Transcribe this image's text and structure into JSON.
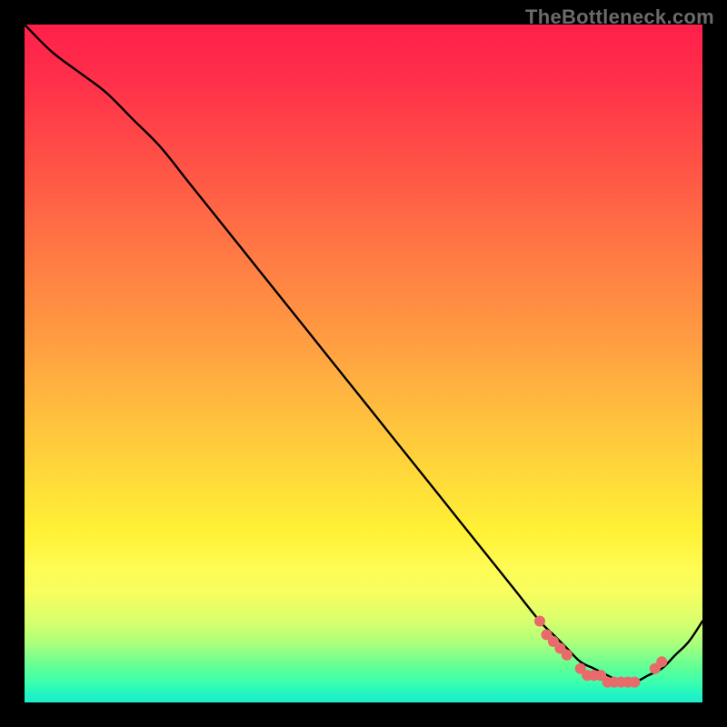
{
  "watermark": "TheBottleneck.com",
  "chart_data": {
    "type": "line",
    "title": "",
    "xlabel": "",
    "ylabel": "",
    "xlim": [
      0,
      100
    ],
    "ylim": [
      0,
      100
    ],
    "grid": false,
    "series": [
      {
        "name": "curve",
        "color": "#000000",
        "x": [
          0,
          4,
          8,
          12,
          16,
          20,
          24,
          28,
          32,
          36,
          40,
          44,
          48,
          52,
          56,
          60,
          64,
          68,
          72,
          76,
          78,
          80,
          82,
          84,
          86,
          88,
          90,
          92,
          94,
          96,
          98,
          100
        ],
        "y": [
          100,
          96,
          93,
          90,
          86,
          82,
          77,
          72,
          67,
          62,
          57,
          52,
          47,
          42,
          37,
          32,
          27,
          22,
          17,
          12,
          10,
          8,
          6,
          5,
          4,
          3,
          3,
          4,
          5,
          7,
          9,
          12
        ]
      },
      {
        "name": "dots",
        "color": "#e86a6a",
        "type": "scatter",
        "x": [
          76,
          77,
          78,
          79,
          80,
          82,
          83,
          84,
          85,
          86,
          87,
          88,
          89,
          90,
          93,
          94
        ],
        "y": [
          12,
          10,
          9,
          8,
          7,
          5,
          4,
          4,
          4,
          3,
          3,
          3,
          3,
          3,
          5,
          6
        ]
      }
    ],
    "gradient_stops": [
      {
        "pos": 0.0,
        "color": "#ff1f4a"
      },
      {
        "pos": 0.22,
        "color": "#ff5646"
      },
      {
        "pos": 0.46,
        "color": "#ff9b42"
      },
      {
        "pos": 0.66,
        "color": "#ffd83a"
      },
      {
        "pos": 0.8,
        "color": "#fffb54"
      },
      {
        "pos": 0.91,
        "color": "#b0ff7a"
      },
      {
        "pos": 1.0,
        "color": "#1ceccb"
      }
    ]
  }
}
